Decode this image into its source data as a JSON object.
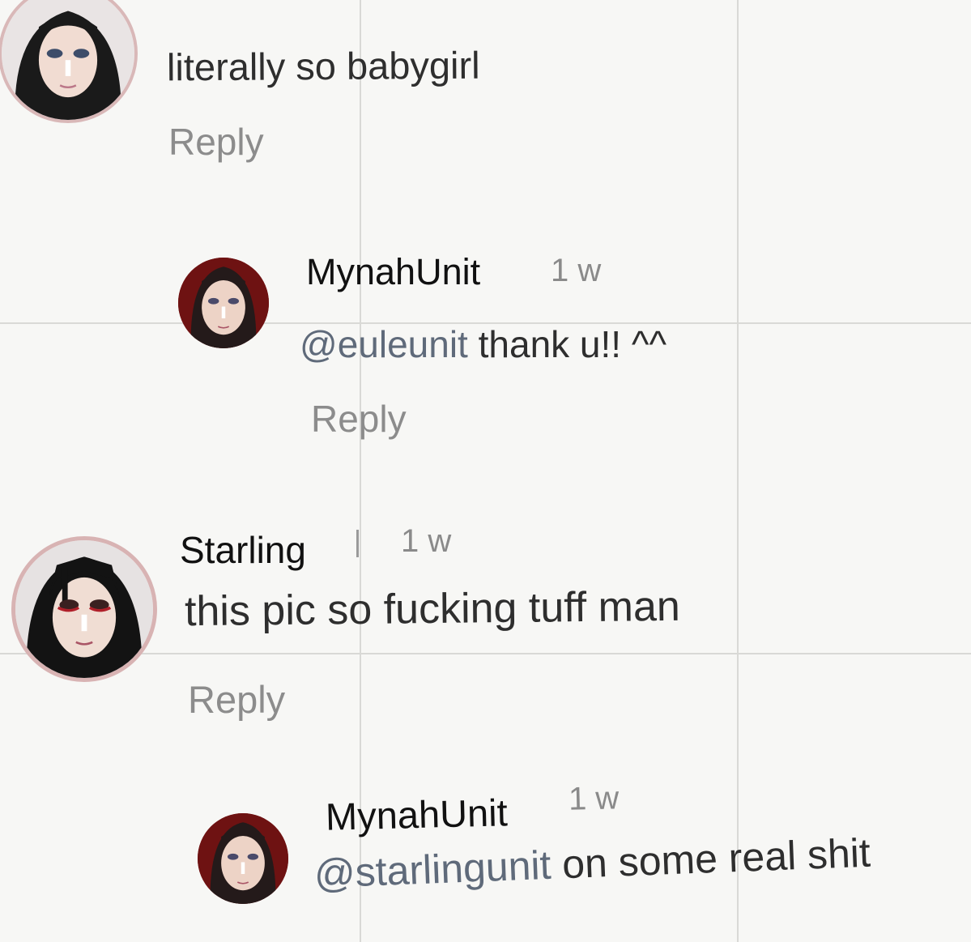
{
  "comments": [
    {
      "body": "literally so babygirl",
      "reply_label": "Reply",
      "avatar_icon": "avatar-icon"
    },
    {
      "username": "MynahUnit",
      "timestamp": "1 w",
      "mention": "@euleunit",
      "body": " thank u!! ^^",
      "reply_label": "Reply",
      "avatar_icon": "avatar-icon"
    },
    {
      "username": "Starling",
      "timestamp": "1 w",
      "body": "this pic so fucking tuff man",
      "reply_label": "Reply",
      "avatar_icon": "avatar-icon"
    },
    {
      "username": "MynahUnit",
      "timestamp": "1 w",
      "mention": "@starlingunit",
      "body": " on some real shit",
      "avatar_icon": "avatar-icon"
    }
  ],
  "colors": {
    "background": "#f7f7f5",
    "username": "#111111",
    "body_text": "#2e2e2e",
    "mention": "#5f6a7a",
    "reply": "#8c8c8c",
    "avatar_ring": "#d4a7a7"
  }
}
